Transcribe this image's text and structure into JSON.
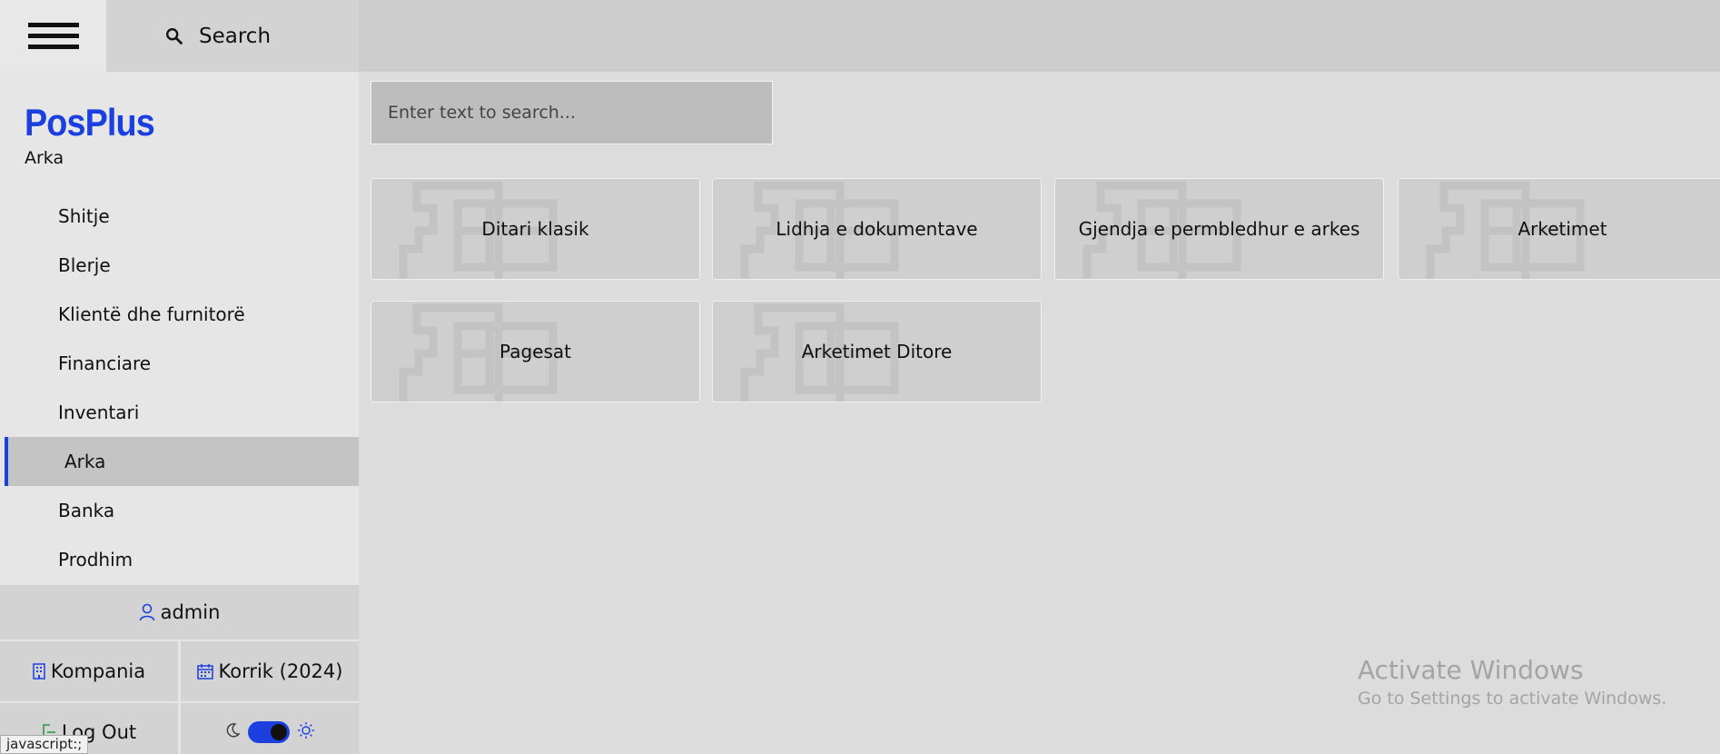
{
  "header": {
    "search_label": "Search"
  },
  "brand": {
    "name": "PosPlus",
    "module": "Arka"
  },
  "nav": {
    "items": [
      {
        "label": "Shitje"
      },
      {
        "label": "Blerje"
      },
      {
        "label": "Klientë dhe furnitorë"
      },
      {
        "label": "Financiare"
      },
      {
        "label": "Inventari"
      },
      {
        "label": "Arka",
        "active": true
      },
      {
        "label": "Banka"
      },
      {
        "label": "Prodhim"
      }
    ]
  },
  "footer": {
    "user": "admin",
    "company": "Kompania",
    "period": "Korrik (2024)",
    "logout": "Log Out"
  },
  "main": {
    "search_placeholder": "Enter text to search...",
    "tiles": [
      {
        "label": "Ditari klasik"
      },
      {
        "label": "Lidhja e dokumentave"
      },
      {
        "label": "Gjendja e permbledhur e arkes"
      },
      {
        "label": "Arketimet"
      },
      {
        "label": "Pagesat"
      },
      {
        "label": "Arketimet Ditore"
      }
    ]
  },
  "watermark": {
    "line1": "Activate Windows",
    "line2": "Go to Settings to activate Windows."
  },
  "status_url": "javascript:;",
  "colors": {
    "accent": "#1c3fe0",
    "sidebar_bg": "#e6e6e6",
    "main_bg": "#dcdcdc",
    "tile_bg": "#cfcfcf"
  }
}
